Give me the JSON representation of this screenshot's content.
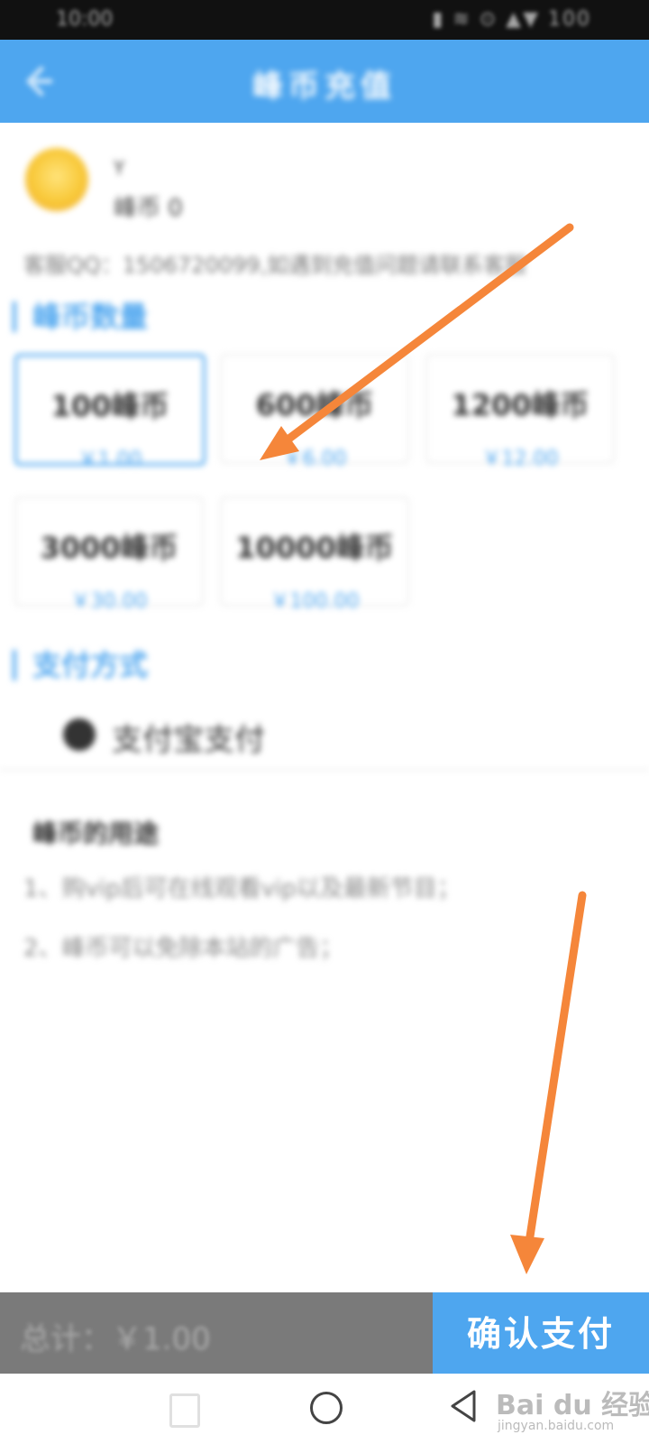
{
  "status_bar": {
    "time": "10:00",
    "icons": "▮ ≋ ⊙ ▲▼ 100"
  },
  "header": {
    "title": "峰币充值"
  },
  "profile": {
    "name": "Y",
    "balance": "峰币 0"
  },
  "notice": "客服QQ：1506720099,如遇到充值问题请联系客服",
  "sections": {
    "amount_title": "峰币数量",
    "payment_title": "支付方式"
  },
  "amounts": [
    {
      "coins": "100峰币",
      "price": "￥1.00",
      "selected": true
    },
    {
      "coins": "600峰币",
      "price": "￥6.00",
      "selected": false
    },
    {
      "coins": "1200峰币",
      "price": "￥12.00",
      "selected": false
    },
    {
      "coins": "3000峰币",
      "price": "￥30.00",
      "selected": false
    },
    {
      "coins": "10000峰币",
      "price": "￥100.00",
      "selected": false
    }
  ],
  "payment_method": {
    "label": "支付宝支付"
  },
  "notes": {
    "title": "峰币的用途",
    "items": [
      "1、购vip后可在线观看vip以及最新节目；",
      "2、峰币可以免除本站的广告；"
    ]
  },
  "bottom_bar": {
    "total": "总计：￥1.00",
    "confirm_label": "确认支付"
  },
  "watermark": {
    "main": "Bai du 经验",
    "sub": "jingyan.baidu.com"
  },
  "colors": {
    "accent": "#4ea6ef",
    "annotation": "#f5863a",
    "total_bar": "#7a7a7a"
  }
}
